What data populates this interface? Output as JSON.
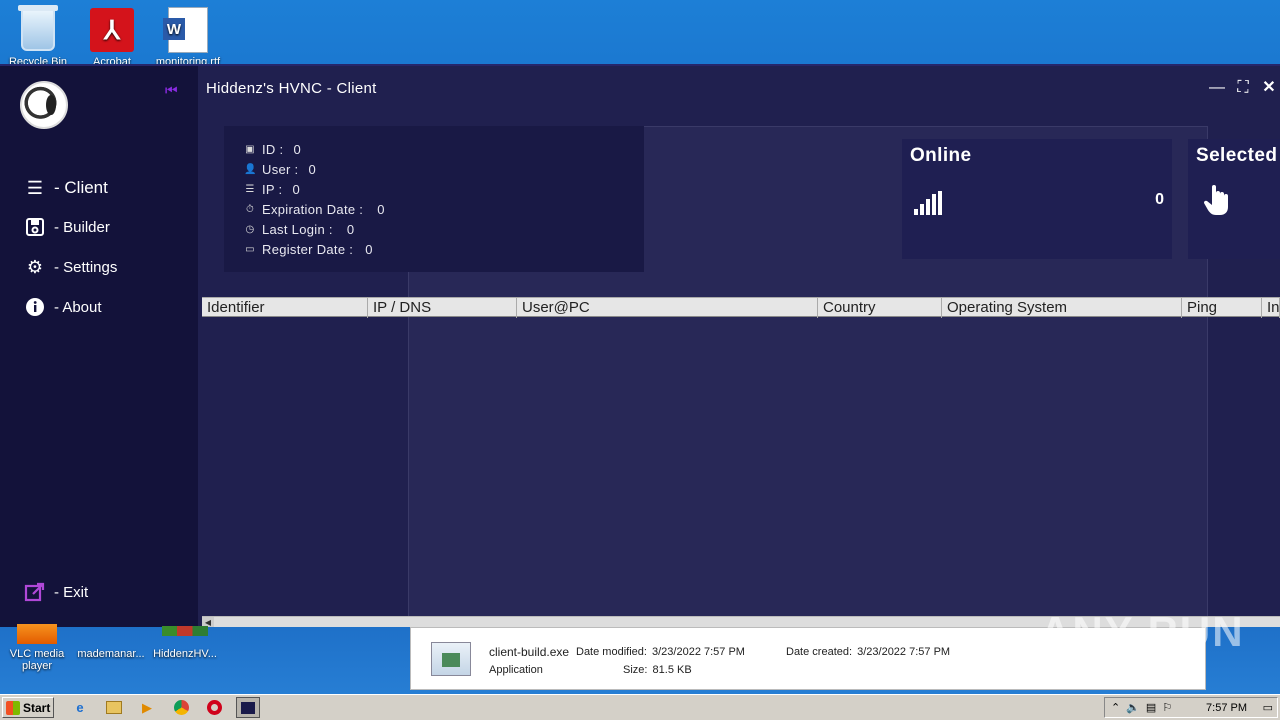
{
  "desktop": {
    "icons": [
      {
        "label": "Recycle Bin",
        "icon": "recycle-bin-icon"
      },
      {
        "label": "Acrobat Reader DC",
        "icon": "pdf-icon"
      },
      {
        "label": "monitoring.rtf",
        "icon": "word-doc-icon"
      }
    ],
    "bottom_icons": [
      {
        "label": "VLC media player"
      },
      {
        "label": "mademanar..."
      },
      {
        "label": "HiddenzHV..."
      }
    ]
  },
  "window": {
    "title": "Hiddenz's HVNC - Client",
    "controls": [
      "minimize",
      "maximize",
      "close"
    ]
  },
  "sidebar": {
    "items": [
      {
        "label": "- Client",
        "icon": "list-icon"
      },
      {
        "label": "- Builder",
        "icon": "save-icon"
      },
      {
        "label": "- Settings",
        "icon": "gears-icon"
      },
      {
        "label": "- About",
        "icon": "info-icon"
      }
    ],
    "exit_label": "- Exit"
  },
  "info": {
    "id_label": "ID :",
    "id_value": "0",
    "user_label": "User :",
    "user_value": "0",
    "ip_label": "IP :",
    "ip_value": "0",
    "expiration_label": "Expiration Date :",
    "expiration_value": "0",
    "last_login_label": "Last Login :",
    "last_login_value": "0",
    "register_label": "Register Date :",
    "register_value": "0"
  },
  "stats": {
    "online_title": "Online",
    "online_value": "0",
    "selected_title": "Selected"
  },
  "table": {
    "columns": [
      "Identifier",
      "IP / DNS",
      "User@PC",
      "Country",
      "Operating System",
      "Ping",
      "In"
    ]
  },
  "file_info": {
    "name": "client-build.exe",
    "type": "Application",
    "modified_label": "Date modified:",
    "modified_value": "3/23/2022 7:57 PM",
    "created_label": "Date created:",
    "created_value": "3/23/2022 7:57 PM",
    "size_label": "Size:",
    "size_value": "81.5 KB"
  },
  "taskbar": {
    "start_label": "Start",
    "clock": "7:57 PM"
  },
  "watermark": "ANY RUN"
}
